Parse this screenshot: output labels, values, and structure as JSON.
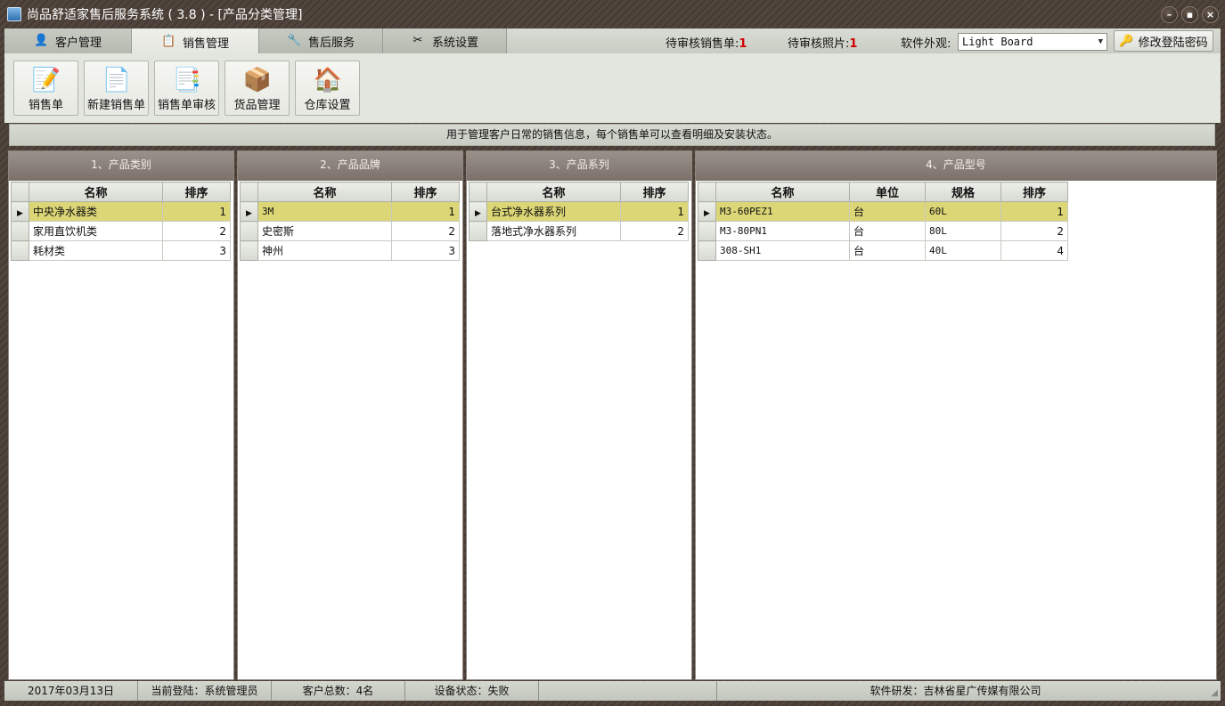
{
  "window": {
    "title": "尚品舒适家售后服务系统 ( 3.8 ) - [产品分类管理]"
  },
  "tabs": [
    {
      "label": "客户管理",
      "icon": "customer-icon"
    },
    {
      "label": "销售管理",
      "icon": "sales-icon"
    },
    {
      "label": "售后服务",
      "icon": "service-icon"
    },
    {
      "label": "系统设置",
      "icon": "settings-icon"
    }
  ],
  "header": {
    "pending_sales_label": "待审核销售单:",
    "pending_sales_count": "1",
    "pending_photos_label": "待审核照片:",
    "pending_photos_count": "1",
    "skin_label": "软件外观:",
    "skin_value": "Light Board",
    "change_password": "修改登陆密码"
  },
  "toolbar": [
    {
      "label": "销售单",
      "icon": "sales-order-icon"
    },
    {
      "label": "新建销售单",
      "icon": "new-sales-order-icon"
    },
    {
      "label": "销售单审核",
      "icon": "sales-review-icon"
    },
    {
      "label": "货品管理",
      "icon": "goods-icon"
    },
    {
      "label": "仓库设置",
      "icon": "warehouse-icon"
    }
  ],
  "info": "用于管理客户日常的销售信息，每个销售单可以查看明细及安装状态。",
  "panels": {
    "category": {
      "title": "1、产品类别",
      "columns": [
        "名称",
        "排序"
      ],
      "rows": [
        [
          "中央净水器类",
          "1"
        ],
        [
          "家用直饮机类",
          "2"
        ],
        [
          "耗材类",
          "3"
        ]
      ]
    },
    "brand": {
      "title": "2、产品品牌",
      "columns": [
        "名称",
        "排序"
      ],
      "rows": [
        [
          "3M",
          "1"
        ],
        [
          "史密斯",
          "2"
        ],
        [
          "神州",
          "3"
        ]
      ]
    },
    "series": {
      "title": "3、产品系列",
      "columns": [
        "名称",
        "排序"
      ],
      "rows": [
        [
          "台式净水器系列",
          "1"
        ],
        [
          "落地式净水器系列",
          "2"
        ]
      ]
    },
    "model": {
      "title": "4、产品型号",
      "columns": [
        "名称",
        "单位",
        "规格",
        "排序"
      ],
      "rows": [
        [
          "M3-60PEZ1",
          "台",
          "60L",
          "1"
        ],
        [
          "M3-80PN1",
          "台",
          "80L",
          "2"
        ],
        [
          "308-SH1",
          "台",
          "40L",
          "4"
        ]
      ]
    }
  },
  "statusbar": {
    "date": "2017年03月13日",
    "login": "当前登陆：系统管理员",
    "customers": "客户总数：4名",
    "device": "设备状态：失败",
    "developer": "软件研发：吉林省星广传媒有限公司"
  }
}
